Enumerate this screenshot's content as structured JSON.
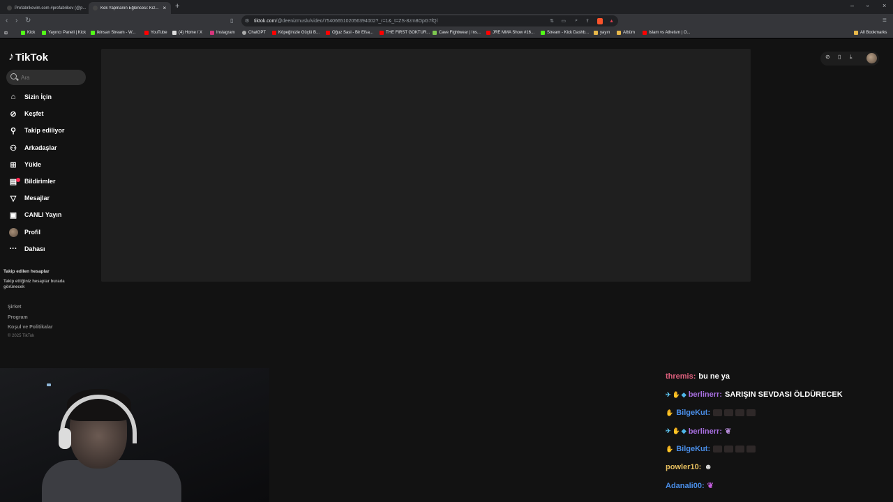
{
  "browser": {
    "tabs": [
      {
        "title": "Prefabrikevim.com #prefabrikev (@p...",
        "active": false
      },
      {
        "title": "Kek Yapmanın Eğlencesi: Kız...",
        "active": true
      }
    ],
    "url_host": "tiktok.com",
    "url_path": "/@deenizmuslu/video/7540665102056394002?_r=1&_t=ZS-8zm8OpG7fQl",
    "bookmarks": [
      "Kick",
      "Yayıncı Paneli | Kick",
      "ikinsan Stream - W...",
      "YouTube",
      "(4) Home / X",
      "Instagram",
      "ChatGPT",
      "Köpeğinizle Güçlü B...",
      "Oğuz Sasi - Bir Efsa...",
      "THE FIRST GOKTUR...",
      "Cave Fightwear | Ins...",
      "JRE MMA Show #16...",
      "Stream - Kick Dashb...",
      "yayın",
      "Albüm",
      "Islam vs Atheism | O..."
    ],
    "all_bookmarks": "All Bookmarks"
  },
  "tiktok": {
    "logo": "TikTok",
    "search_placeholder": "Ara",
    "nav": [
      {
        "label": "Sizin İçin",
        "icon": "home-icon"
      },
      {
        "label": "Keşfet",
        "icon": "compass-icon"
      },
      {
        "label": "Takip ediliyor",
        "icon": "following-icon"
      },
      {
        "label": "Arkadaşlar",
        "icon": "friends-icon"
      },
      {
        "label": "Yükle",
        "icon": "upload-icon"
      },
      {
        "label": "Bildirimler",
        "icon": "inbox-icon"
      },
      {
        "label": "Mesajlar",
        "icon": "message-icon"
      },
      {
        "label": "CANLI Yayın",
        "icon": "live-icon"
      },
      {
        "label": "Profil",
        "icon": "avatar"
      },
      {
        "label": "Dahası",
        "icon": "more-icon"
      }
    ],
    "followed_title": "Takip edilen hesaplar",
    "followed_desc": "Takip ettiğiniz hesaplar burada görünecek",
    "footer": [
      "Şirket",
      "Program",
      "Koşul ve Politikalar"
    ],
    "copyright": "© 2025 TikTok"
  },
  "chat": [
    {
      "user": "thremis:",
      "color": "#e0607e",
      "text": "bu ne ya",
      "badges": []
    },
    {
      "user": "berlinerr:",
      "color": "#a86fe0",
      "text": "SARIŞIN SEVDASI ÖLDÜRECEK",
      "badges": [
        "sword",
        "hand",
        "cube"
      ]
    },
    {
      "user": "BilgeKut:",
      "color": "#4a8ee8",
      "text": "",
      "badges": [
        "hand"
      ],
      "emotes": 4
    },
    {
      "user": "berlinerr:",
      "color": "#a86fe0",
      "text": "",
      "badges": [
        "sword",
        "hand",
        "cube"
      ],
      "emote_icon": "eggplant-emote"
    },
    {
      "user": "BilgeKut:",
      "color": "#4a8ee8",
      "text": "",
      "badges": [
        "hand"
      ],
      "emotes": 4
    },
    {
      "user": "powler10:",
      "color": "#e8c060",
      "text": "",
      "badges": [],
      "emote_icon": "person-emote"
    },
    {
      "user": "Adanali00:",
      "color": "#4a8ee8",
      "text": "",
      "badges": [],
      "emote_icon": "eggplant-emote"
    }
  ]
}
